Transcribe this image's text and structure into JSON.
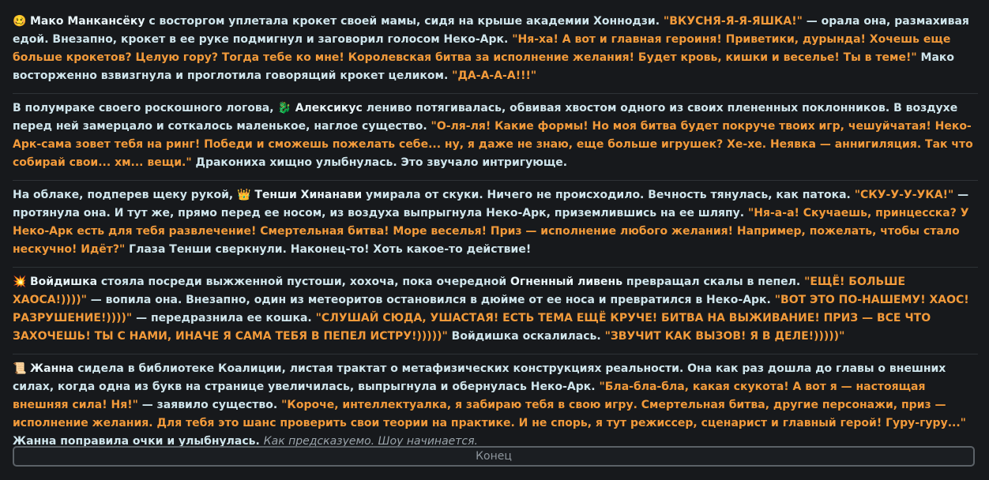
{
  "paragraphs": [
    {
      "icon": "🥴",
      "icon_name": "woozy-face-icon",
      "segments": [
        {
          "type": "name",
          "text": "Мако Манкансёку"
        },
        {
          "type": "text",
          "text": " с восторгом уплетала крокет своей мамы, сидя на крыше академии Хоннодзи. "
        },
        {
          "type": "quote",
          "text": "\"ВКУСНЯ-Я-Я-ЯШКА!\""
        },
        {
          "type": "text",
          "text": " — орала она, размахивая едой. Внезапно, крокет в ее руке подмигнул и заговорил голосом Неко-Арк. "
        },
        {
          "type": "quote",
          "text": "\"Ня-ха! А вот и главная героиня! Приветики, дурында! Хочешь еще больше крокетов? Целую гору? Тогда тебе ко мне! Королевская битва за исполнение желания! Будет кровь, кишки и веселье! Ты в теме!\""
        },
        {
          "type": "text",
          "text": " Мако восторженно взвизгнула и проглотила говорящий крокет целиком. "
        },
        {
          "type": "quote",
          "text": "\"ДА-А-А-А!!!\""
        }
      ]
    },
    {
      "icon": "",
      "icon_name": "",
      "segments": [
        {
          "type": "text",
          "text": "В полумраке своего роскошного логова, 🐉 "
        },
        {
          "type": "name",
          "text": "Алексикус"
        },
        {
          "type": "text",
          "text": " лениво потягивалась, обвивая хвостом одного из своих плененных поклонников. В воздухе перед ней замерцало и соткалось маленькое, наглое существо. "
        },
        {
          "type": "quote",
          "text": "\"О-ля-ля! Какие формы! Но моя битва будет покруче твоих игр, чешуйчатая! Неко-Арк-сама зовет тебя на ринг! Победи и сможешь пожелать себе... ну, я даже не знаю, еще больше игрушек? Хе-хе. Неявка — аннигиляция. Так что собирай свои... хм... вещи.\""
        },
        {
          "type": "text",
          "text": " Дракониха хищно улыбнулась. Это звучало интригующе."
        }
      ]
    },
    {
      "icon": "",
      "icon_name": "",
      "segments": [
        {
          "type": "text",
          "text": "На облаке, подперев щеку рукой, 👑 "
        },
        {
          "type": "name",
          "text": "Тенши Хинанави"
        },
        {
          "type": "text",
          "text": " умирала от скуки. Ничего не происходило. Вечность тянулась, как патока. "
        },
        {
          "type": "quote",
          "text": "\"СКУ-У-У-УКА!\""
        },
        {
          "type": "text",
          "text": " — протянула она. И тут же, прямо перед ее носом, из воздуха выпрыгнула Неко-Арк, приземлившись на ее шляпу. "
        },
        {
          "type": "quote",
          "text": "\"Ня-а-а! Скучаешь, принцесска? У Неко-Арк есть для тебя развлечение! Смертельная битва! Море веселья! Приз — исполнение любого желания! Например, пожелать, чтобы стало нескучно! Идёт?\""
        },
        {
          "type": "text",
          "text": " Глаза Тенши сверкнули. Наконец-то! Хоть какое-то действие!"
        }
      ]
    },
    {
      "icon": "💥",
      "icon_name": "explosion-icon",
      "segments": [
        {
          "type": "name",
          "text": "Войдишка"
        },
        {
          "type": "text",
          "text": " стояла посреди выжженной пустоши, хохоча, пока очередной "
        },
        {
          "type": "name",
          "text": "Огненный ливень"
        },
        {
          "type": "text",
          "text": " превращал скалы в пепел. "
        },
        {
          "type": "quote",
          "text": "\"ЕЩЁ! БОЛЬШЕ ХАОСА!))))\""
        },
        {
          "type": "text",
          "text": " — вопила она. Внезапно, один из метеоритов остановился в дюйме от ее носа и превратился в Неко-Арк. "
        },
        {
          "type": "quote",
          "text": "\"ВОТ ЭТО ПО-НАШЕМУ! ХАОС! РАЗРУШЕНИЕ!))))\""
        },
        {
          "type": "text",
          "text": " — передразнила ее кошка. "
        },
        {
          "type": "quote",
          "text": "\"СЛУШАЙ СЮДА, УШАСТАЯ! ЕСТЬ ТЕМА ЕЩЁ КРУЧЕ! БИТВА НА ВЫЖИВАНИЕ! ПРИЗ — ВСЕ ЧТО ЗАХОЧЕШЬ! ТЫ С НАМИ, ИНАЧЕ Я САМА ТЕБЯ В ПЕПЕЛ ИСТРУ!)))))\""
        },
        {
          "type": "text",
          "text": " Войдишка оскалилась. "
        },
        {
          "type": "quote",
          "text": "\"ЗВУЧИТ КАК ВЫЗОВ! Я В ДЕЛЕ!)))))\""
        }
      ]
    },
    {
      "icon": "📜",
      "icon_name": "scroll-icon",
      "segments": [
        {
          "type": "name",
          "text": "Жанна"
        },
        {
          "type": "text",
          "text": " сидела в библиотеке Коалиции, листая трактат о метафизических конструкциях реальности. Она как раз дошла до главы о внешних силах, когда одна из букв на странице увеличилась, выпрыгнула и обернулась Неко-Арк. "
        },
        {
          "type": "quote",
          "text": "\"Бла-бла-бла, какая скукота! А вот я — настоящая внешняя сила! Ня!\""
        },
        {
          "type": "text",
          "text": " — заявило существо. "
        },
        {
          "type": "quote",
          "text": "\"Короче, интеллектуалка, я забираю тебя в свою игру. Смертельная битва, другие персонажи, приз — исполнение желания. Для тебя это шанс проверить свои теории на практике. И не спорь, я тут режиссер, сценарист и главный герой! Гуру-гуру...\""
        },
        {
          "type": "text",
          "text": " Жанна поправила очки и улыбнулась. "
        },
        {
          "type": "italic",
          "text": "Как предсказуемо. Шоу начинается."
        }
      ]
    }
  ],
  "end_button": {
    "label": "Конец"
  }
}
